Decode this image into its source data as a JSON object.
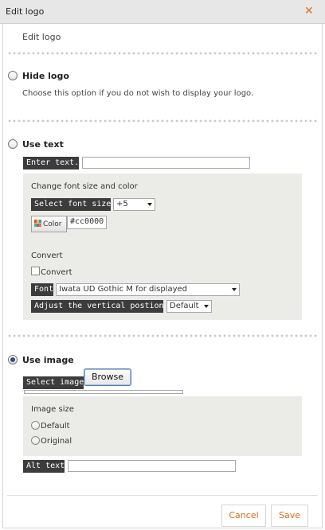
{
  "dialog": {
    "title": "Edit logo",
    "subtitle": "Edit logo"
  },
  "hide_logo": {
    "label": "Hide logo",
    "description": "Choose this option if you do not wish to display your logo."
  },
  "use_text": {
    "label": "Use text",
    "enter_text_label": "Enter text.",
    "enter_text_value": "",
    "font_section_title": "Change font size and color",
    "font_size_label": "Select font size",
    "font_size_value": "+5",
    "color_button_label": "Color",
    "color_value": "#cc0000",
    "convert_title": "Convert",
    "convert_checkbox_label": "Convert",
    "font_label": "Font",
    "font_value": "Iwata UD Gothic M for displayed",
    "vertical_label": "Adjust the vertical postion",
    "vertical_value": "Default"
  },
  "use_image": {
    "label": "Use image",
    "selected": true,
    "select_image_label": "Select image",
    "browse_label": "Browse",
    "image_size_title": "Image size",
    "size_options": [
      "Default",
      "Original"
    ],
    "alt_text_label": "Alt text",
    "alt_text_value": ""
  },
  "footer": {
    "cancel_label": "Cancel",
    "save_label": "Save"
  },
  "colors": {
    "accent": "#e06a1e",
    "dark_label": "#3c3c3c",
    "panel": "#ebebe7"
  },
  "icons": {
    "close": "close-icon",
    "color_swatch": "color-palette-icon"
  }
}
